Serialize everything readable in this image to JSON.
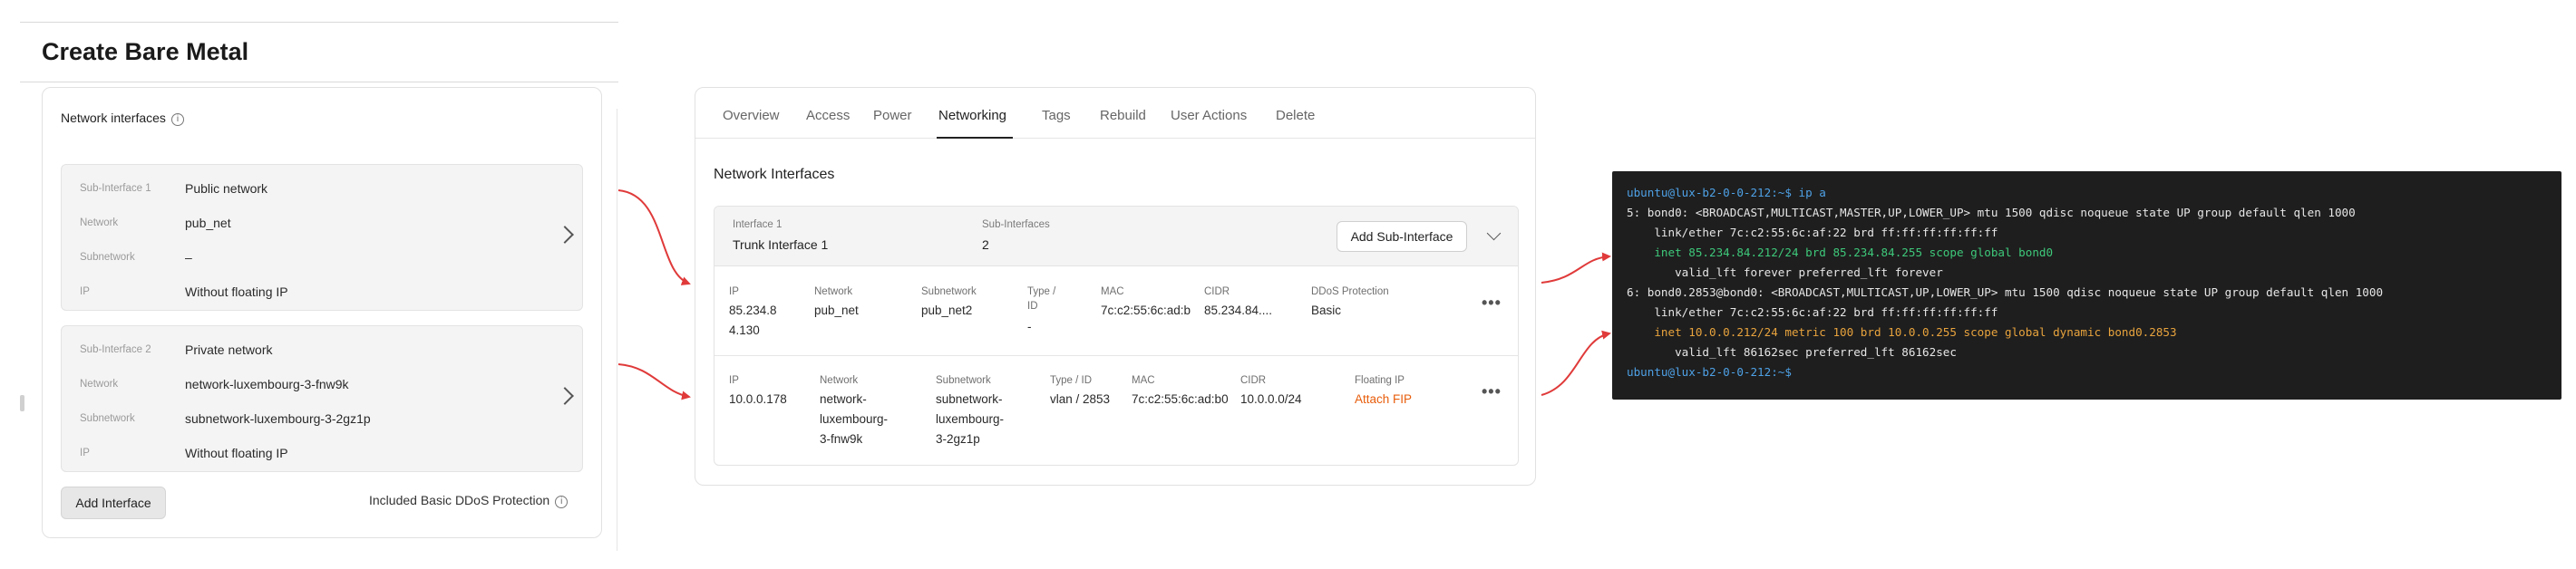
{
  "left": {
    "page_title": "Create Bare Metal",
    "card_title": "Network interfaces",
    "info_glyph": "i",
    "subinterfaces": [
      {
        "rows": [
          {
            "key": "Sub-Interface 1",
            "value": "Public network"
          },
          {
            "key": "Network",
            "value": "pub_net"
          },
          {
            "key": "Subnetwork",
            "value": "–"
          },
          {
            "key": "IP",
            "value": "Without floating IP"
          }
        ]
      },
      {
        "rows": [
          {
            "key": "Sub-Interface 2",
            "value": "Private network"
          },
          {
            "key": "Network",
            "value": "network-luxembourg-3-fnw9k"
          },
          {
            "key": "Subnetwork",
            "value": "subnetwork-luxembourg-3-2gz1p"
          },
          {
            "key": "IP",
            "value": "Without floating IP"
          }
        ]
      }
    ],
    "add_interface_label": "Add Interface",
    "ddos_included_label": "Included Basic DDoS Protection"
  },
  "middle": {
    "tabs": [
      "Overview",
      "Access",
      "Power",
      "Networking",
      "Tags",
      "Rebuild",
      "User Actions",
      "Delete"
    ],
    "active_tab": "Networking",
    "section_title": "Network Interfaces",
    "interface": {
      "interface_key": "Interface 1",
      "interface_value": "Trunk Interface 1",
      "subif_key": "Sub-Interfaces",
      "subif_value": "2",
      "add_subif_label": "Add Sub-Interface"
    },
    "rows": [
      {
        "ip_key": "IP",
        "ip_lines": [
          "85.234.8",
          "4.130"
        ],
        "network_key": "Network",
        "network_lines": [
          "pub_net"
        ],
        "subnet_key": "Subnetwork",
        "subnet_lines": [
          "pub_net2"
        ],
        "type_key_lines": [
          "Type /",
          "ID"
        ],
        "type_lines": [
          "-"
        ],
        "mac_key": "MAC",
        "mac_lines": [
          "7c:c2:55:6c:ad:b"
        ],
        "cidr_key": "CIDR",
        "cidr_lines": [
          "85.234.84...."
        ],
        "extra_key": "DDoS Protection",
        "extra_value": "Basic",
        "more": "•••"
      },
      {
        "ip_key": "IP",
        "ip_lines": [
          "10.0.0.178"
        ],
        "network_key": "Network",
        "network_lines": [
          "network-",
          "luxembourg-",
          "3-fnw9k"
        ],
        "subnet_key": "Subnetwork",
        "subnet_lines": [
          "subnetwork-",
          "luxembourg-",
          "3-2gz1p"
        ],
        "type_key_lines": [
          "Type / ID"
        ],
        "type_lines": [
          "vlan / 2853"
        ],
        "mac_key": "MAC",
        "mac_lines": [
          "7c:c2:55:6c:ad:b0"
        ],
        "cidr_key": "CIDR",
        "cidr_lines": [
          "10.0.0.0/24"
        ],
        "extra_key": "Floating IP",
        "extra_value": "Attach FIP",
        "more": "•••"
      }
    ]
  },
  "terminal": {
    "lines": [
      "ubuntu@lux-b2-0-0-212:~$ ip a",
      "5: bond0: <BROADCAST,MULTICAST,MASTER,UP,LOWER_UP> mtu 1500 qdisc noqueue state UP group default qlen 1000",
      "    link/ether 7c:c2:55:6c:af:22 brd ff:ff:ff:ff:ff:ff",
      "    inet 85.234.84.212/24 brd 85.234.84.255 scope global bond0",
      "       valid_lft forever preferred_lft forever",
      "6: bond0.2853@bond0: <BROADCAST,MULTICAST,UP,LOWER_UP> mtu 1500 qdisc noqueue state UP group default qlen 1000",
      "    link/ether 7c:c2:55:6c:af:22 brd ff:ff:ff:ff:ff:ff",
      "    inet 10.0.0.212/24 metric 100 brd 10.0.0.255 scope global dynamic bond0.2853",
      "       valid_lft 86162sec preferred_lft 86162sec",
      "ubuntu@lux-b2-0-0-212:~$"
    ],
    "line_colors": [
      "blue",
      "default",
      "default",
      "green",
      "default",
      "default",
      "default",
      "orange",
      "default",
      "blue"
    ]
  },
  "colors": {
    "arrow": "#e03a3a",
    "accent_orange": "#e85d0c",
    "terminal_bg": "#1e1e1e"
  }
}
